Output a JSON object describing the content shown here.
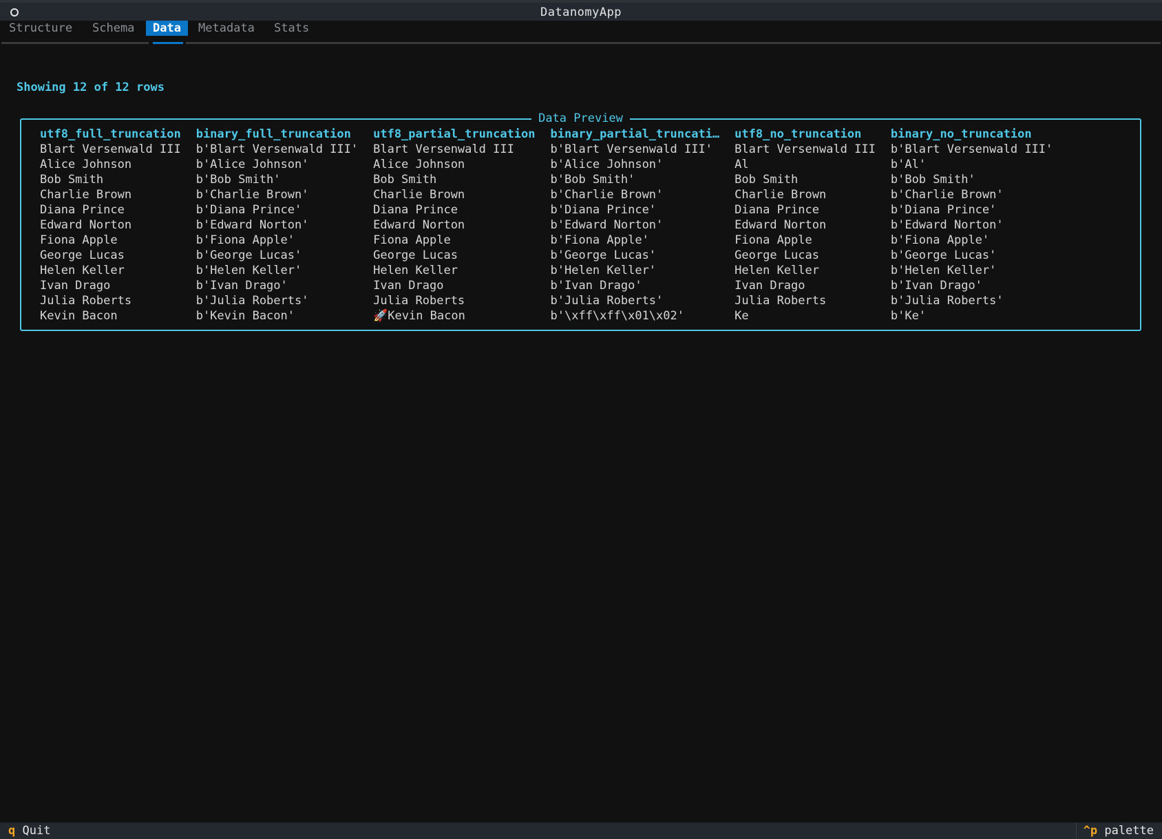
{
  "window": {
    "title": "DatanomyApp"
  },
  "tabs": [
    {
      "label": "Structure",
      "active": false
    },
    {
      "label": "Schema",
      "active": false
    },
    {
      "label": "Data",
      "active": true
    },
    {
      "label": "Metadata",
      "active": false
    },
    {
      "label": "Stats",
      "active": false
    }
  ],
  "info": {
    "rows_text": "Showing 12 of 12 rows"
  },
  "preview": {
    "title": "Data Preview",
    "columns": [
      "utf8_full_truncation",
      "binary_full_truncation",
      "utf8_partial_truncation",
      "binary_partial_truncati…",
      "utf8_no_truncation",
      "binary_no_truncation"
    ],
    "rows": [
      [
        "Blart Versenwald III",
        "b'Blart Versenwald III'",
        "Blart Versenwald III",
        "b'Blart Versenwald III'",
        "Blart Versenwald III",
        "b'Blart Versenwald III'"
      ],
      [
        "Alice Johnson",
        "b'Alice Johnson'",
        "Alice Johnson",
        "b'Alice Johnson'",
        "Al",
        "b'Al'"
      ],
      [
        "Bob Smith",
        "b'Bob Smith'",
        "Bob Smith",
        "b'Bob Smith'",
        "Bob Smith",
        "b'Bob Smith'"
      ],
      [
        "Charlie Brown",
        "b'Charlie Brown'",
        "Charlie Brown",
        "b'Charlie Brown'",
        "Charlie Brown",
        "b'Charlie Brown'"
      ],
      [
        "Diana Prince",
        "b'Diana Prince'",
        "Diana Prince",
        "b'Diana Prince'",
        "Diana Prince",
        "b'Diana Prince'"
      ],
      [
        "Edward Norton",
        "b'Edward Norton'",
        "Edward Norton",
        "b'Edward Norton'",
        "Edward Norton",
        "b'Edward Norton'"
      ],
      [
        "Fiona Apple",
        "b'Fiona Apple'",
        "Fiona Apple",
        "b'Fiona Apple'",
        "Fiona Apple",
        "b'Fiona Apple'"
      ],
      [
        "George Lucas",
        "b'George Lucas'",
        "George Lucas",
        "b'George Lucas'",
        "George Lucas",
        "b'George Lucas'"
      ],
      [
        "Helen Keller",
        "b'Helen Keller'",
        "Helen Keller",
        "b'Helen Keller'",
        "Helen Keller",
        "b'Helen Keller'"
      ],
      [
        "Ivan Drago",
        "b'Ivan Drago'",
        "Ivan Drago",
        "b'Ivan Drago'",
        "Ivan Drago",
        "b'Ivan Drago'"
      ],
      [
        "Julia Roberts",
        "b'Julia Roberts'",
        "Julia Roberts",
        "b'Julia Roberts'",
        "Julia Roberts",
        "b'Julia Roberts'"
      ],
      [
        "Kevin Bacon",
        "b'Kevin Bacon'",
        "🚀Kevin Bacon",
        "b'\\xff\\xff\\x01\\x02'",
        "Ke",
        "b'Ke'"
      ]
    ]
  },
  "footer": {
    "quit_key": "q",
    "quit_label": "Quit",
    "palette_key": "^p",
    "palette_label": "palette"
  },
  "colors": {
    "accent": "#4fc8e8",
    "active_tab": "#0a77c9",
    "key_highlight": "#f5a623",
    "background": "#111111"
  }
}
